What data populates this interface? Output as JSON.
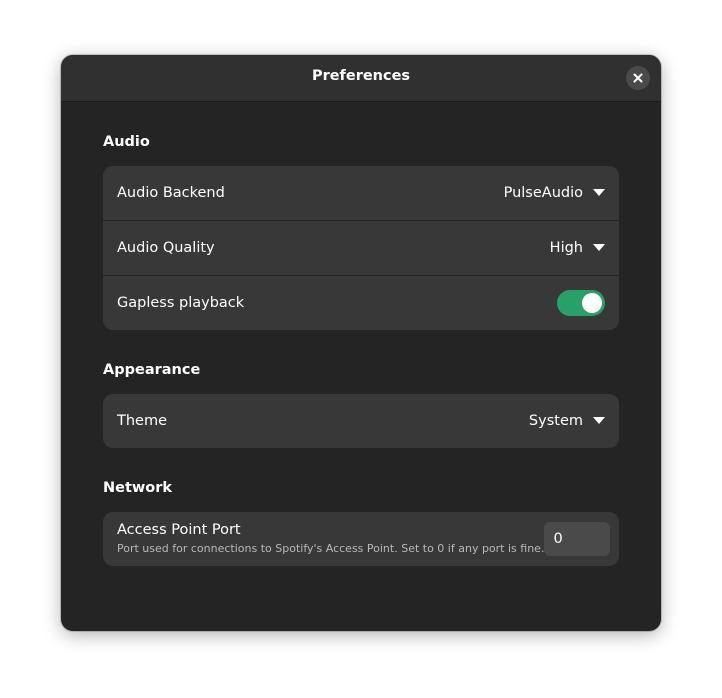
{
  "window": {
    "title": "Preferences"
  },
  "sections": {
    "audio": {
      "title": "Audio",
      "backend_label": "Audio Backend",
      "backend_value": "PulseAudio",
      "quality_label": "Audio Quality",
      "quality_value": "High",
      "gapless_label": "Gapless playback",
      "gapless_enabled": true
    },
    "appearance": {
      "title": "Appearance",
      "theme_label": "Theme",
      "theme_value": "System"
    },
    "network": {
      "title": "Network",
      "port_label": "Access Point Port",
      "port_subtitle": "Port used for connections to Spotify's Access Point. Set to 0 if any port is fine.",
      "port_value": "0"
    }
  },
  "colors": {
    "window_bg": "#242424",
    "headerbar_bg": "#303030",
    "row_bg": "#383838",
    "accent_toggle": "#26a269"
  },
  "icons": {
    "close": "close-icon",
    "dropdown": "pan-down-icon"
  }
}
